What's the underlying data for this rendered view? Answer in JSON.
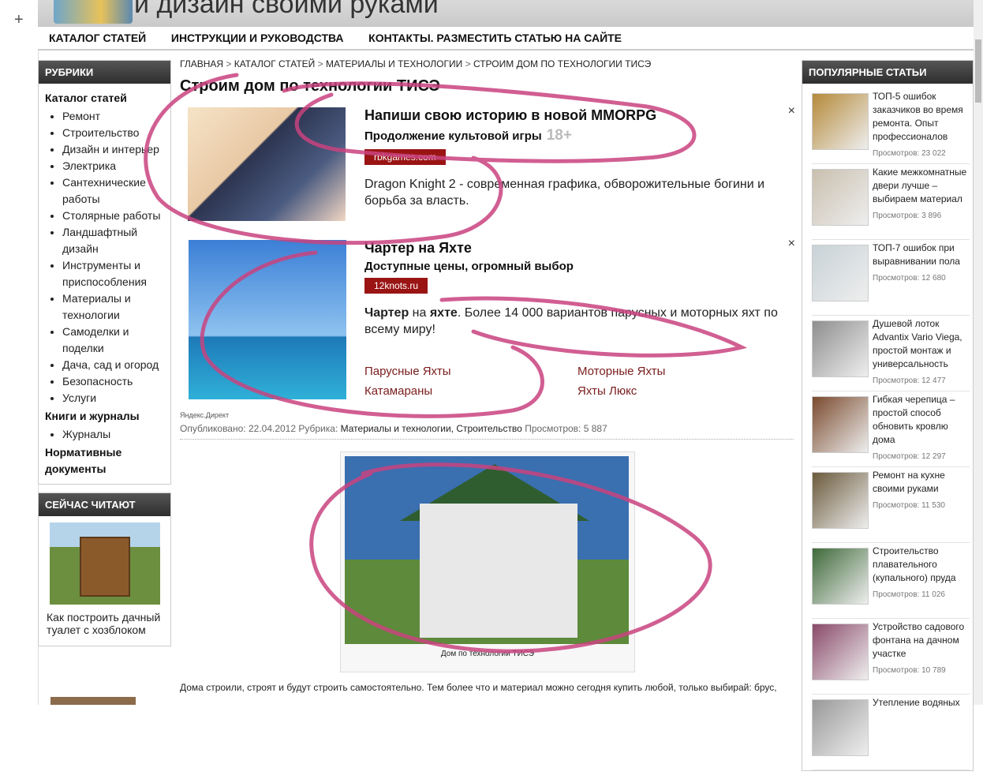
{
  "site": {
    "name": "и дизайн своими руками"
  },
  "nav": [
    "КАТАЛОГ СТАТЕЙ",
    "ИНСТРУКЦИИ И РУКОВОДСТВА",
    "КОНТАКТЫ. РАЗМЕСТИТЬ СТАТЬЮ НА САЙТЕ"
  ],
  "left": {
    "rubrics_title": "РУБРИКИ",
    "catalog": "Каталог статей",
    "items": [
      "Ремонт",
      "Строительство",
      "Дизайн и интерьер",
      "Электрика",
      "Сантехнические работы",
      "Столярные работы",
      "Ландшафтный дизайн",
      "Инструменты и приспособления",
      "Материалы и технологии",
      "Самоделки и поделки",
      "Дача, сад и огород",
      "Безопасность",
      "Услуги"
    ],
    "books": "Книги и журналы",
    "journals": "Журналы",
    "normative": "Нормативные документы",
    "reading_title": "СЕЙЧАС ЧИТАЮТ",
    "reading_caption": "Как построить дачный туалет с хозблоком"
  },
  "breadcrumb": [
    "ГЛАВНАЯ",
    "КАТАЛОГ СТАТЕЙ",
    "МАТЕРИАЛЫ И ТЕХНОЛОГИИ",
    "СТРОИМ ДОМ ПО ТЕХНОЛОГИИ ТИСЭ"
  ],
  "breadcrumb_sep": ">",
  "title": "Строим дом по технологии ТИСЭ",
  "ad1": {
    "title": "Напиши свою историю в новой MMORPG",
    "subtitle": "Продолжение культовой игры",
    "age": "18+",
    "domain": "rbkgames.com",
    "desc": "Dragon Knight 2 - современная графика, обворожительные богини и борьба за власть."
  },
  "ad2": {
    "title": "Чартер на Яхте",
    "subtitle": "Доступные цены, огромный выбор",
    "domain": "12knots.ru",
    "desc_b1": "Чартер",
    "desc_m1": " на ",
    "desc_b2": "яхте",
    "desc_rest": ". Более 14 000 вариантов парусных и моторных яхт по всему миру!",
    "links": [
      "Парусные Яхты",
      "Моторные Яхты",
      "Катамараны",
      "Яхты Люкс"
    ]
  },
  "close_glyph": "×",
  "yandex": "Яндекс.Директ",
  "meta": {
    "published_label": "Опубликовано:",
    "date": "22.04.2012",
    "rubric_label": "Рубрика:",
    "rubrics": "Материалы и технологии, Строительство",
    "views_label": "Просмотров:",
    "views": "5 887"
  },
  "figure_caption": "Дом по технологии ТИСЭ",
  "body_text": "Дома строили, строят и будут строить самостоятельно. Тем более что и материал можно сегодня купить любой, только выбирай: брус,",
  "right": {
    "title": "ПОПУЛЯРНЫЕ СТАТЬИ",
    "views_label": "Просмотров:",
    "items": [
      {
        "title": "ТОП-5 ошибок заказчиков во время ремонта. Опыт профессионалов",
        "views": "23 022",
        "color": "#b58a3a"
      },
      {
        "title": "Какие межкомнатные двери лучше – выбираем материал",
        "views": "3 896",
        "color": "#c9bfae"
      },
      {
        "title": "ТОП-7 ошибок при выравнивании пола",
        "views": "12 680",
        "color": "#c8d2d6"
      },
      {
        "title": "Душевой лоток Advantix Vario Viega, простой монтаж и универсальность",
        "views": "12 477",
        "color": "#8e8e8e"
      },
      {
        "title": "Гибкая черепица – простой способ обновить кровлю дома",
        "views": "12 297",
        "color": "#7a4a2e"
      },
      {
        "title": "Ремонт на кухне своими руками",
        "views": "11 530",
        "color": "#6b5a3c"
      },
      {
        "title": "Строительство плавательного (купального) пруда",
        "views": "11 026",
        "color": "#3f6a3a"
      },
      {
        "title": "Устройство садового фонтана на дачном участке",
        "views": "10 789",
        "color": "#8a4a6a"
      },
      {
        "title": "Утепление водяных",
        "views": "",
        "color": "#999"
      }
    ]
  },
  "colors": {
    "annotation": "#c9437f",
    "ad_domain_bg": "#9a1414",
    "link": "#7a1c1c"
  }
}
